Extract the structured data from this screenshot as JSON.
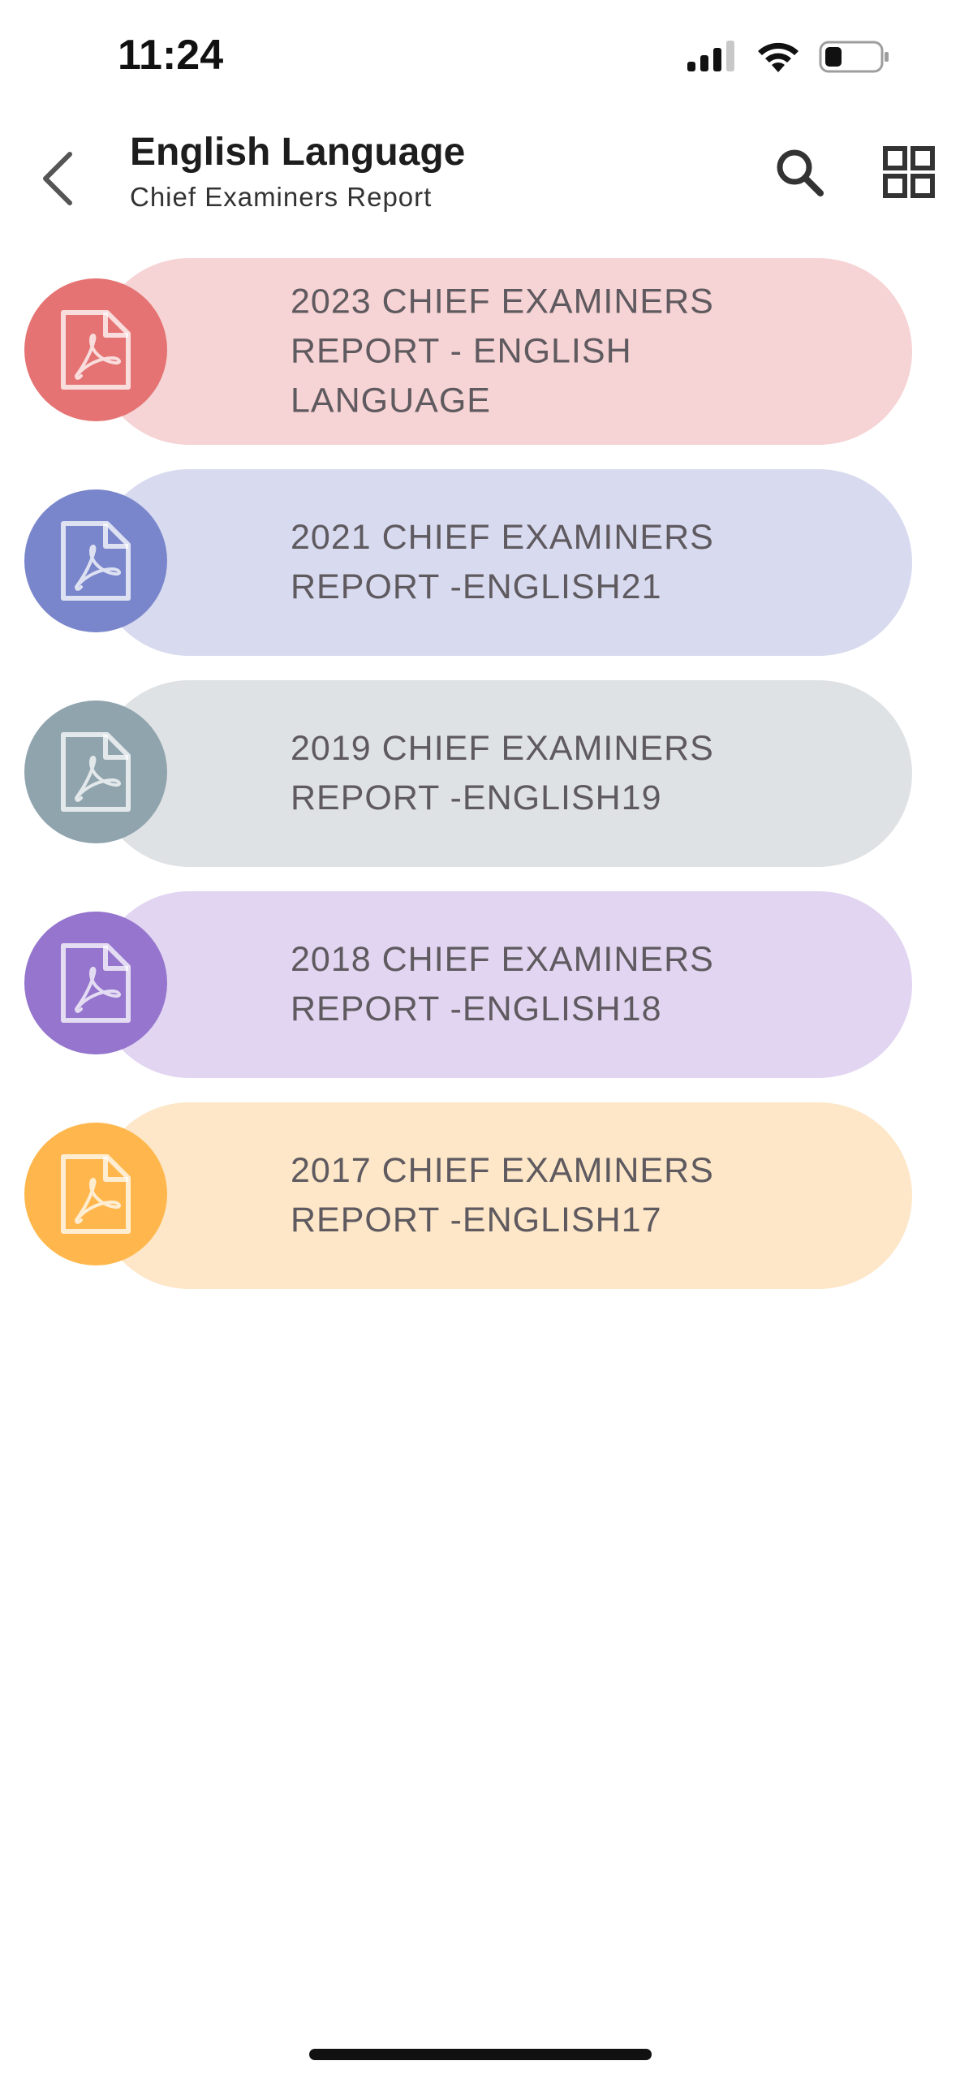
{
  "status_bar": {
    "time": "11:24"
  },
  "header": {
    "title": "English Language",
    "subtitle": "Chief Examiners Report"
  },
  "icons": {
    "back": "chevron-left-icon",
    "search": "search-icon",
    "view_toggle": "grid-icon",
    "item": "pdf-file-icon",
    "item_arrow": "chevron-right-icon"
  },
  "reports": [
    {
      "label": "2023 CHIEF EXAMINERS REPORT - ENGLISH LANGUAGE",
      "pill_color": "#f6d3d4",
      "circle_color": "#e57373"
    },
    {
      "label": "2021 CHIEF EXAMINERS REPORT -ENGLISH21",
      "pill_color": "#d8daef",
      "circle_color": "#7986cb"
    },
    {
      "label": "2019 CHIEF EXAMINERS REPORT -ENGLISH19",
      "pill_color": "#dfe2e5",
      "circle_color": "#90a4ae"
    },
    {
      "label": "2018 CHIEF EXAMINERS REPORT -ENGLISH18",
      "pill_color": "#e1d5f1",
      "circle_color": "#9575cd"
    },
    {
      "label": "2017 CHIEF EXAMINERS REPORT -ENGLISH17",
      "pill_color": "#fde7c8",
      "circle_color": "#ffb74d"
    }
  ]
}
